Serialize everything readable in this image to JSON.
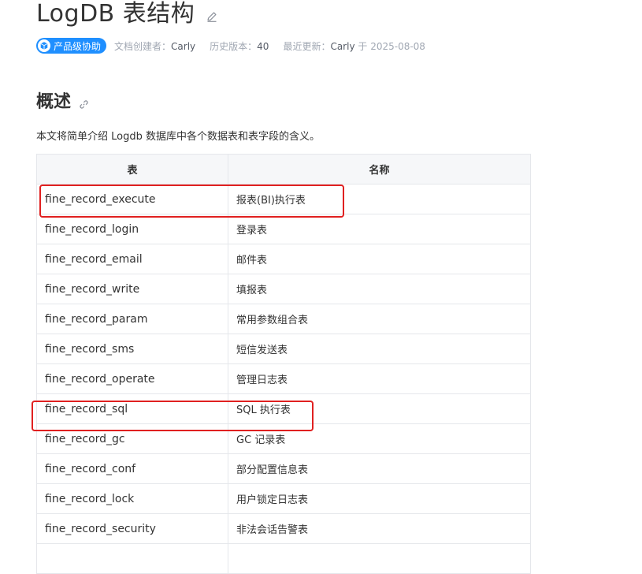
{
  "page": {
    "title": "LogDB 表结构",
    "badge": "产品级协助",
    "meta": {
      "creator_label": "文档创建者：",
      "creator": "Carly",
      "version_label": "历史版本：",
      "version": "40",
      "updated_label": "最近更新：",
      "updated_by": "Carly",
      "updated_on": "于 2025-08-08"
    }
  },
  "overview": {
    "heading": "概述",
    "intro": "本文将简单介绍 Logdb 数据库中各个数据表和表字段的含义。"
  },
  "table": {
    "headers": [
      "表",
      "名称"
    ],
    "rows": [
      {
        "name": "fine_record_execute",
        "desc": "报表(BI)执行表",
        "highlighted": true
      },
      {
        "name": "fine_record_login",
        "desc": "登录表"
      },
      {
        "name": "fine_record_email",
        "desc": "邮件表"
      },
      {
        "name": "fine_record_write",
        "desc": "填报表"
      },
      {
        "name": "fine_record_param",
        "desc": "常用参数组合表"
      },
      {
        "name": "fine_record_sms",
        "desc": "短信发送表"
      },
      {
        "name": "fine_record_operate",
        "desc": "管理日志表"
      },
      {
        "name": "fine_record_sql",
        "desc": "SQL 执行表",
        "highlighted": true
      },
      {
        "name": "fine_record_gc",
        "desc": "GC 记录表"
      },
      {
        "name": "fine_record_conf",
        "desc": "部分配置信息表"
      },
      {
        "name": "fine_record_lock",
        "desc": "用户锁定日志表"
      },
      {
        "name": "fine_record_security",
        "desc": "非法会话告警表"
      }
    ]
  },
  "colors": {
    "badge": "#1f8fff",
    "highlight": "#e02020",
    "header_bg": "#f6f7f9",
    "border": "#e5e7eb"
  },
  "icons": [
    "edit-icon",
    "link-icon",
    "cube-icon"
  ]
}
